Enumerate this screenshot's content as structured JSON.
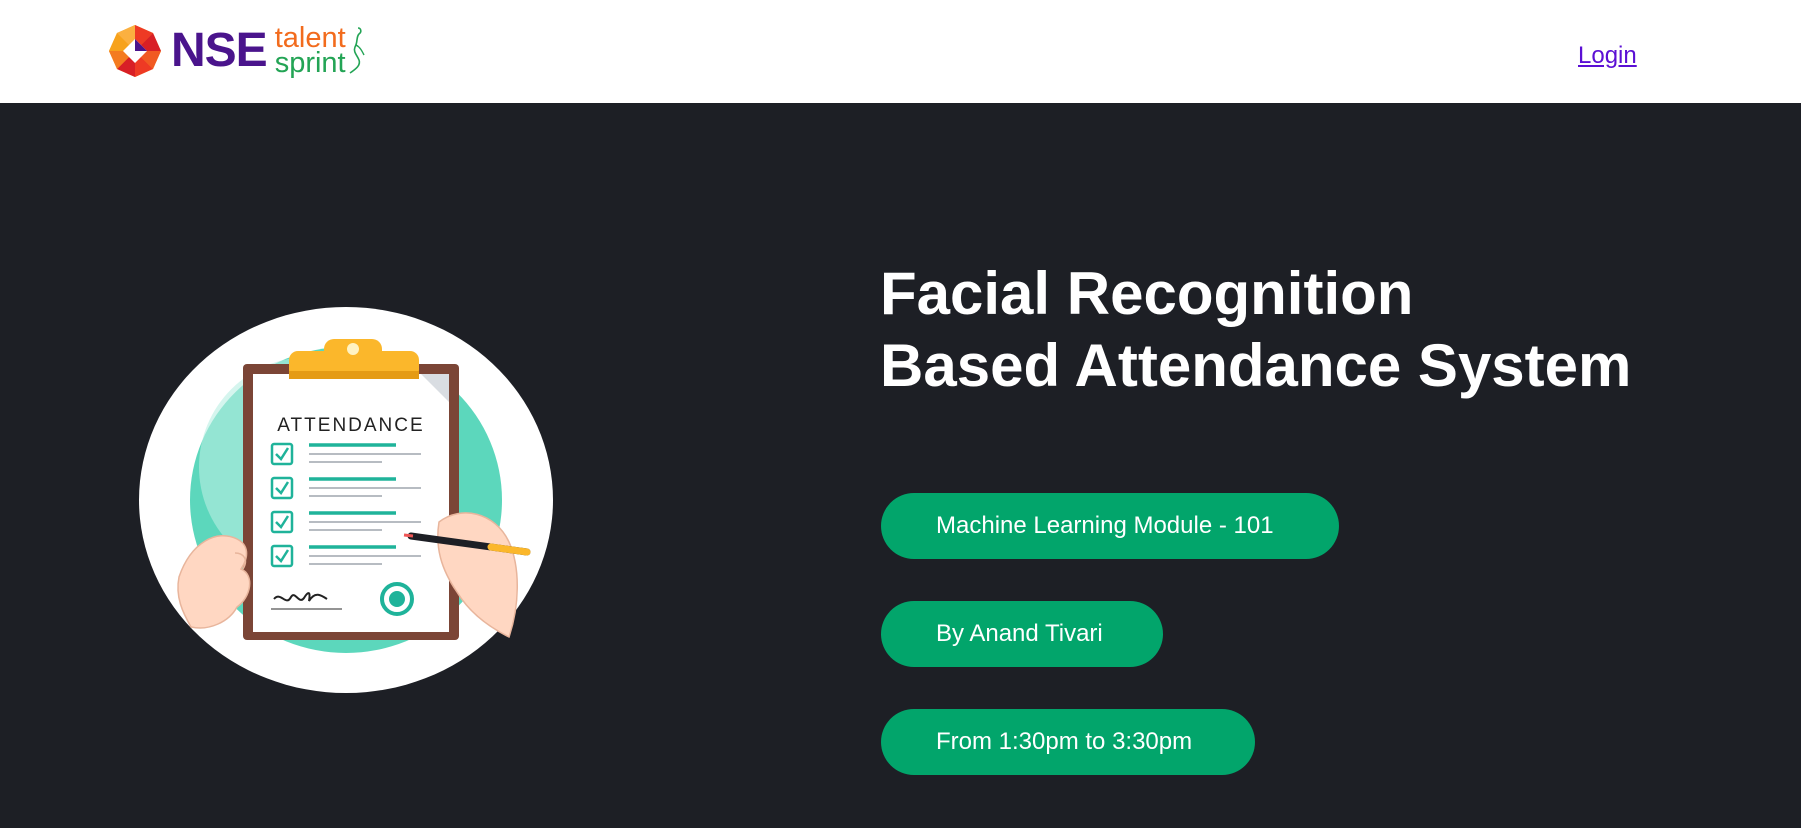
{
  "header": {
    "logo": {
      "brand": "NSE",
      "sub_brand_top": "talent",
      "sub_brand_bottom": "sprint",
      "mark_icon": "nse-diamond-logo-icon"
    },
    "login_label": "Login"
  },
  "hero": {
    "title_line1": "Facial Recognition",
    "title_line2": "Based Attendance System",
    "illustration": {
      "icon": "attendance-clipboard-illustration",
      "heading": "ATTENDANCE"
    },
    "pills": [
      {
        "label": "Machine Learning Module - 101"
      },
      {
        "label": "By Anand Tivari"
      },
      {
        "label": "From 1:30pm to 3:30pm"
      }
    ]
  },
  "colors": {
    "background": "#1d1f25",
    "header_bg": "#ffffff",
    "pill_green": "#02a56b",
    "nse_purple": "#4a148c",
    "talent_orange": "#f26b1d",
    "sprint_green": "#23a455",
    "link": "#5b0fd4"
  }
}
